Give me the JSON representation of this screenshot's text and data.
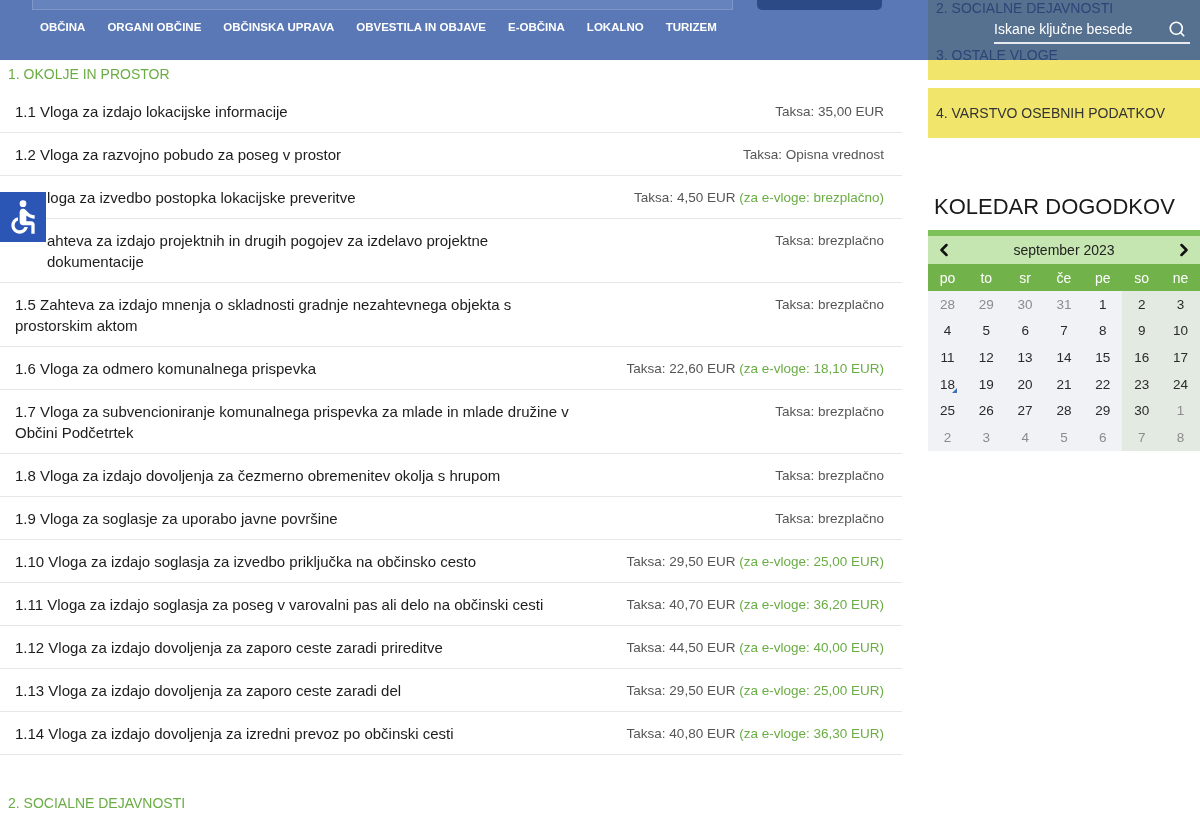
{
  "header": {
    "nav": [
      "OBČINA",
      "ORGANI OBČINE",
      "OBČINSKA UPRAVA",
      "OBVESTILA IN OBJAVE",
      "E-OBČINA",
      "LOKALNO",
      "TURIZEM"
    ],
    "search": {
      "placeholder": "Iskane ključne besede"
    }
  },
  "sections": [
    {
      "title": "1. OKOLJE IN PROSTOR",
      "items": [
        {
          "title": "1.1 Vloga za izdajo lokacijske informacije",
          "fee": "Taksa: 35,00 EUR",
          "partly_hidden": false
        },
        {
          "title": "1.2 Vloga za razvojno pobudo za poseg v prostor",
          "fee": "Taksa: Opisna vrednost",
          "partly_hidden": false
        },
        {
          "title": "loga za izvedbo postopka lokacijske preveritve",
          "fee": "Taksa: 4,50 EUR",
          "e_fee": "(za e-vloge: brezplačno)",
          "partly_hidden": true
        },
        {
          "title": "ahteva za izdajo projektnih in drugih pogojev za izdelavo projektne dokumentacije",
          "fee": "Taksa: brezplačno",
          "partly_hidden": true
        },
        {
          "title": "1.5 Zahteva za izdajo mnenja o skladnosti gradnje nezahtevnega objekta s prostorskim aktom",
          "fee": "Taksa: brezplačno",
          "partly_hidden": false
        },
        {
          "title": "1.6 Vloga za odmero komunalnega prispevka",
          "fee": "Taksa: 22,60 EUR",
          "e_fee": "(za e-vloge: 18,10 EUR)",
          "partly_hidden": false
        },
        {
          "title": "1.7 Vloga za subvencioniranje komunalnega prispevka za mlade in mlade družine v Občini Podčetrtek",
          "fee": "Taksa: brezplačno",
          "partly_hidden": false
        },
        {
          "title": "1.8 Vloga za izdajo dovoljenja za čezmerno obremenitev okolja s hrupom",
          "fee": "Taksa: brezplačno",
          "partly_hidden": false
        },
        {
          "title": "1.9 Vloga za soglasje za uporabo javne površine",
          "fee": "Taksa: brezplačno",
          "partly_hidden": false
        },
        {
          "title": "1.10 Vloga za izdajo soglasja za izvedbo priključka na občinsko cesto",
          "fee": "Taksa: 29,50 EUR",
          "e_fee": "(za e-vloge: 25,00 EUR)",
          "partly_hidden": false
        },
        {
          "title": "1.11 Vloga za izdajo soglasja za poseg v varovalni pas ali delo na občinski cesti",
          "fee": "Taksa: 40,70 EUR",
          "e_fee": "(za e-vloge: 36,20 EUR)",
          "partly_hidden": false
        },
        {
          "title": "1.12 Vloga za izdajo dovoljenja za zaporo ceste zaradi prireditve",
          "fee": "Taksa: 44,50 EUR",
          "e_fee": "(za e-vloge: 40,00 EUR)",
          "partly_hidden": false
        },
        {
          "title": "1.13 Vloga za izdajo dovoljenja za zaporo ceste zaradi del",
          "fee": "Taksa: 29,50 EUR",
          "e_fee": "(za e-vloge: 25,00 EUR)",
          "partly_hidden": false
        },
        {
          "title": "1.14 Vloga za izdajo dovoljenja za izredni prevoz po občinski cesti",
          "fee": "Taksa: 40,80 EUR",
          "e_fee": "(za e-vloge: 36,30 EUR)",
          "partly_hidden": false
        }
      ]
    },
    {
      "title": "2. SOCIALNE DEJAVNOSTI"
    }
  ],
  "sidebar": {
    "categories": [
      {
        "label": "2. SOCIALNE DEJAVNOSTI",
        "under_header": true
      },
      {
        "label": "3. OSTALE VLOGE",
        "under_header": true
      },
      {
        "label": "4. VARSTVO OSEBNIH PODATKOV",
        "under_header": false
      }
    ],
    "calendar": {
      "title": "KOLEDAR DOGODKOV",
      "month": "september 2023",
      "weekdays": [
        "po",
        "to",
        "sr",
        "če",
        "pe",
        "so",
        "ne"
      ],
      "weeks": [
        [
          {
            "day": "28",
            "other_month": true,
            "event": false
          },
          {
            "day": "29",
            "other_month": true,
            "event": false
          },
          {
            "day": "30",
            "other_month": true,
            "event": false
          },
          {
            "day": "31",
            "other_month": true,
            "event": false
          },
          {
            "day": "1",
            "other_month": false,
            "event": false
          },
          {
            "day": "2",
            "other_month": false,
            "event": false
          },
          {
            "day": "3",
            "other_month": false,
            "event": false
          }
        ],
        [
          {
            "day": "4",
            "other_month": false,
            "event": false
          },
          {
            "day": "5",
            "other_month": false,
            "event": false
          },
          {
            "day": "6",
            "other_month": false,
            "event": false
          },
          {
            "day": "7",
            "other_month": false,
            "event": false
          },
          {
            "day": "8",
            "other_month": false,
            "event": false
          },
          {
            "day": "9",
            "other_month": false,
            "event": false
          },
          {
            "day": "10",
            "other_month": false,
            "event": false
          }
        ],
        [
          {
            "day": "11",
            "other_month": false,
            "event": false
          },
          {
            "day": "12",
            "other_month": false,
            "event": false
          },
          {
            "day": "13",
            "other_month": false,
            "event": false
          },
          {
            "day": "14",
            "other_month": false,
            "event": false
          },
          {
            "day": "15",
            "other_month": false,
            "event": false
          },
          {
            "day": "16",
            "other_month": false,
            "event": false
          },
          {
            "day": "17",
            "other_month": false,
            "event": false
          }
        ],
        [
          {
            "day": "18",
            "other_month": false,
            "event": true
          },
          {
            "day": "19",
            "other_month": false,
            "event": false
          },
          {
            "day": "20",
            "other_month": false,
            "event": false
          },
          {
            "day": "21",
            "other_month": false,
            "event": false
          },
          {
            "day": "22",
            "other_month": false,
            "event": false
          },
          {
            "day": "23",
            "other_month": false,
            "event": false
          },
          {
            "day": "24",
            "other_month": false,
            "event": false
          }
        ],
        [
          {
            "day": "25",
            "other_month": false,
            "event": false
          },
          {
            "day": "26",
            "other_month": false,
            "event": false
          },
          {
            "day": "27",
            "other_month": false,
            "event": false
          },
          {
            "day": "28",
            "other_month": false,
            "event": false
          },
          {
            "day": "29",
            "other_month": false,
            "event": false
          },
          {
            "day": "30",
            "other_month": false,
            "event": false
          },
          {
            "day": "1",
            "other_month": true,
            "event": false
          }
        ],
        [
          {
            "day": "2",
            "other_month": true,
            "event": false
          },
          {
            "day": "3",
            "other_month": true,
            "event": false
          },
          {
            "day": "4",
            "other_month": true,
            "event": false
          },
          {
            "day": "5",
            "other_month": true,
            "event": false
          },
          {
            "day": "6",
            "other_month": true,
            "event": false
          },
          {
            "day": "7",
            "other_month": true,
            "event": false
          },
          {
            "day": "8",
            "other_month": true,
            "event": false
          }
        ]
      ]
    }
  }
}
